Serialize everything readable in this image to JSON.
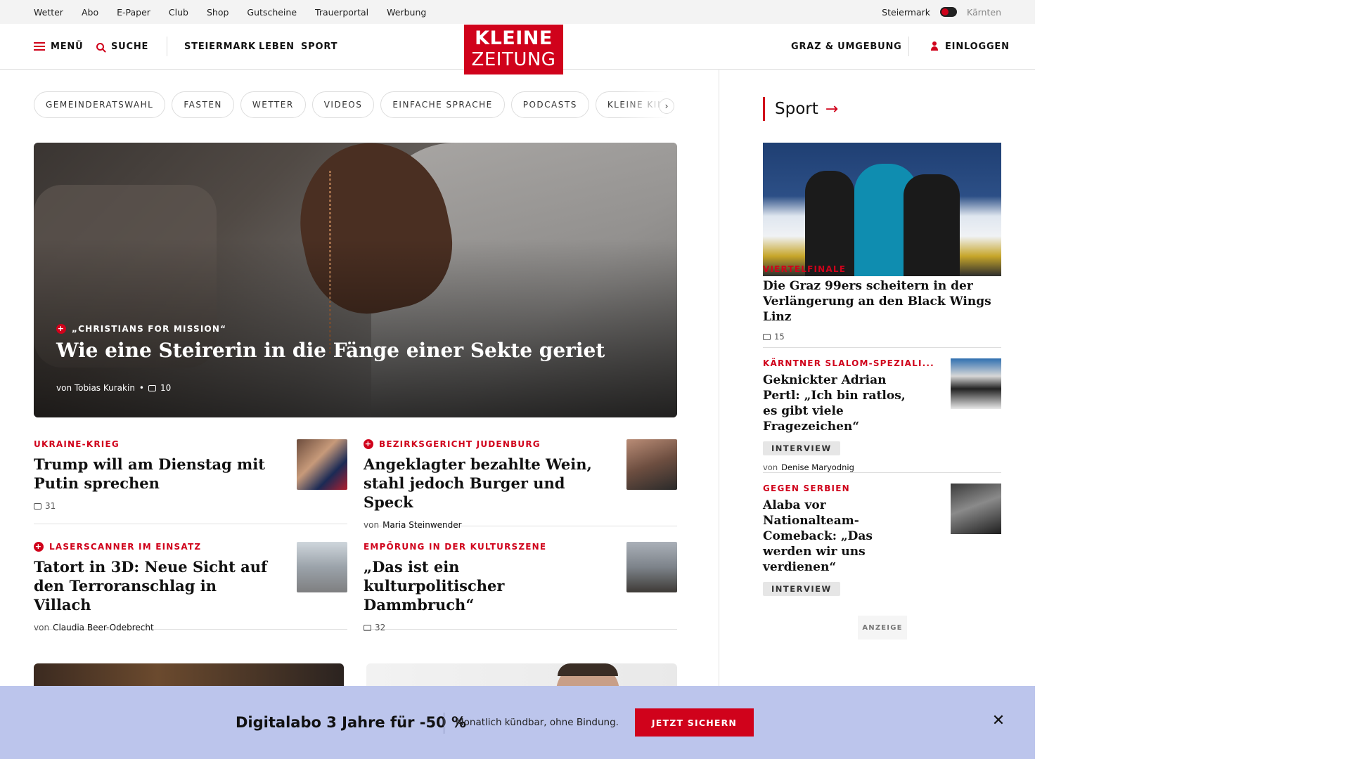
{
  "utility": {
    "links": [
      "Wetter",
      "Abo",
      "E-Paper",
      "Club",
      "Shop",
      "Gutscheine",
      "Trauerportal",
      "Werbung"
    ],
    "region_active": "Steiermark",
    "region_inactive": "Kärnten"
  },
  "header": {
    "menu": "MENÜ",
    "search": "SUCHE",
    "nav": [
      "STEIERMARK",
      "LEBEN",
      "SPORT"
    ],
    "logo_line1": "KLEINE",
    "logo_line2": "ZEITUNG",
    "location": "GRAZ & UMGEBUNG",
    "login": "EINLOGGEN"
  },
  "tags": [
    "GEMEINDERATSWAHL",
    "FASTEN",
    "WETTER",
    "VIDEOS",
    "EINFACHE SPRACHE",
    "PODCASTS",
    "KLEINE KINDE"
  ],
  "hero": {
    "kicker": "„CHRISTIANS FOR MISSION“",
    "headline": "Wie eine Steirerin in die Fänge einer Sekte geriet",
    "author": "von Tobias Kurakin",
    "comments": "10"
  },
  "articles": [
    {
      "kicker": "UKRAINE-KRIEG",
      "title": "Trump will am Dienstag mit Putin sprechen",
      "comments": "31",
      "author": "",
      "premium": false
    },
    {
      "kicker": "BEZIRKSGERICHT JUDENBURG",
      "title": "Angeklagter bezahlte Wein, stahl jedoch Burger und Speck",
      "author": "Maria Steinwender",
      "comments": "",
      "premium": true
    },
    {
      "kicker": "LASERSCANNER IM EINSATZ",
      "title": "Tatort in 3D: Neue Sicht auf den Terroranschlag in Villach",
      "author": "Claudia Beer-Odebrecht",
      "comments": "",
      "premium": true
    },
    {
      "kicker": "EMPÖRUNG IN DER KULTURSZENE",
      "title": "„Das ist ein kulturpolitischer Dammbruch“",
      "comments": "32",
      "author": "",
      "premium": false
    }
  ],
  "byline_prefix": "von",
  "sport": {
    "section": "Sport",
    "lead": {
      "kicker": "VIERTELFINALE",
      "title": "Die Graz 99ers scheitern in der Verlängerung an den Black Wings Linz",
      "comments": "15"
    },
    "items": [
      {
        "kicker": "KÄRNTNER SLALOM-SPEZIALI...",
        "title": "Geknickter Adrian Pertl: „Ich bin ratlos, es gibt viele Fragezeichen“",
        "badge": "INTERVIEW",
        "author": "Denise Maryodnig"
      },
      {
        "kicker": "GEGEN SERBIEN",
        "title": "Alaba vor Nationalteam-Comeback: „Das werden wir uns verdienen“",
        "badge": "INTERVIEW",
        "author": ""
      }
    ],
    "ad": "ANZEIGE"
  },
  "promo": {
    "headline": "Digitalabo 3 Jahre für -50 %",
    "sub": "Monatlich kündbar, ohne Bindung.",
    "button": "JETZT SICHERN"
  },
  "colors": {
    "brand": "#d0021b",
    "promo_bg": "#bcc5ec"
  }
}
